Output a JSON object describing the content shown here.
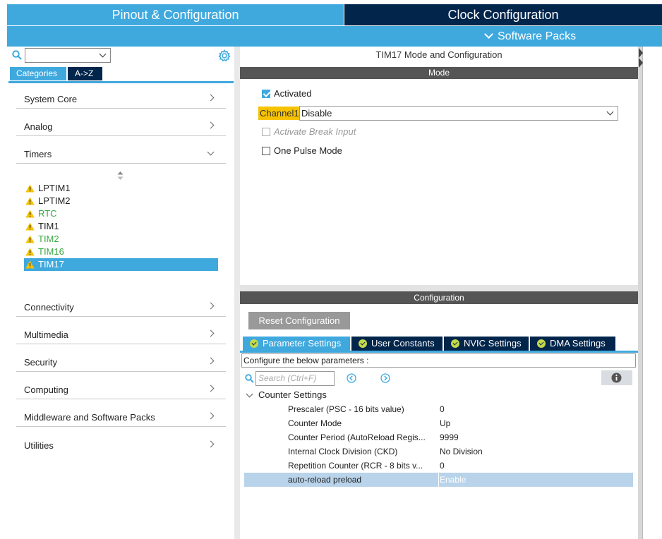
{
  "header": {
    "tab_pinout": "Pinout & Configuration",
    "tab_clock": "Clock Configuration",
    "software_packs": "Software Packs"
  },
  "left": {
    "search_value": "",
    "tab_categories": "Categories",
    "tab_az": "A->Z",
    "categories": [
      {
        "label": "System Core"
      },
      {
        "label": "Analog"
      },
      {
        "label": "Timers"
      },
      {
        "label": "Connectivity"
      },
      {
        "label": "Multimedia"
      },
      {
        "label": "Security"
      },
      {
        "label": "Computing"
      },
      {
        "label": "Middleware and Software Packs"
      },
      {
        "label": "Utilities"
      }
    ],
    "timers": [
      {
        "label": "LPTIM1",
        "color": "#222222"
      },
      {
        "label": "LPTIM2",
        "color": "#222222"
      },
      {
        "label": "RTC",
        "color": "#3aa845"
      },
      {
        "label": "TIM1",
        "color": "#222222"
      },
      {
        "label": "TIM2",
        "color": "#3aa845"
      },
      {
        "label": "TIM16",
        "color": "#3aa845"
      },
      {
        "label": "TIM17",
        "color": "#ffffff"
      }
    ]
  },
  "mode": {
    "title": "TIM17 Mode and Configuration",
    "section": "Mode",
    "activated_label": "Activated",
    "activated": true,
    "channel1_label": "Channel1",
    "channel1_value": "Disable",
    "break_input_label": "Activate Break Input",
    "one_pulse_label": "One Pulse Mode"
  },
  "config": {
    "section": "Configuration",
    "reset_label": "Reset Configuration",
    "tabs": [
      {
        "label": "Parameter Settings"
      },
      {
        "label": "User Constants"
      },
      {
        "label": "NVIC Settings"
      },
      {
        "label": "DMA Settings"
      }
    ],
    "description": "Configure the below parameters :",
    "search_placeholder": "Search (Ctrl+F)",
    "group": "Counter Settings",
    "params": [
      {
        "name": "Prescaler (PSC - 16 bits value)",
        "value": "0"
      },
      {
        "name": "Counter Mode",
        "value": "Up"
      },
      {
        "name": "Counter Period (AutoReload Regis...",
        "value": "9999"
      },
      {
        "name": "Internal Clock Division (CKD)",
        "value": "No Division"
      },
      {
        "name": "Repetition Counter (RCR - 8 bits v...",
        "value": "0"
      },
      {
        "name": "auto-reload preload",
        "value": "Enable"
      }
    ]
  },
  "colors": {
    "accent": "#3fa9de",
    "navy": "#02254b",
    "warning": "#f7c300",
    "enabled_green": "#3aa845"
  }
}
